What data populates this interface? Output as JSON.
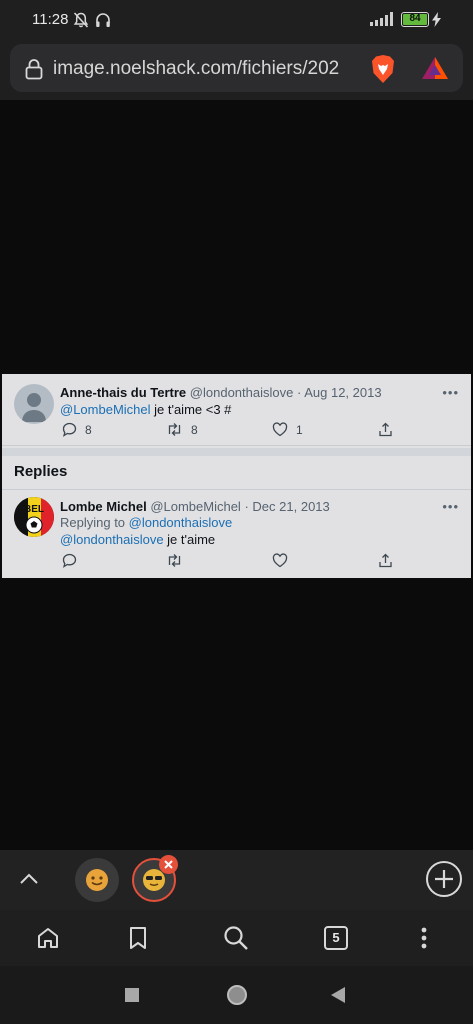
{
  "status_bar": {
    "time": "11:28",
    "battery": "84",
    "icons": [
      "mute-bell-icon",
      "headphones-icon",
      "signal-icon",
      "battery-icon",
      "charging-icon"
    ]
  },
  "browser": {
    "url": "image.noelshack.com/fichiers/202",
    "icons": [
      "lock-icon",
      "brave-shields-icon",
      "brave-rewards-icon"
    ],
    "accent": "#e5503b"
  },
  "tweet": {
    "name": "Anne-thais du Tertre",
    "handle": "@londonthaislove",
    "separator": "·",
    "date": "Aug 12, 2013",
    "mention": "@LombeMichel",
    "text": " je t'aime <3 #",
    "replies": "8",
    "retweets": "8",
    "likes": "1",
    "more": "•••"
  },
  "replies_section": {
    "title": "Replies"
  },
  "reply": {
    "name": "Lombe Michel",
    "handle": "@LombeMichel",
    "separator": "·",
    "date": "Dec 21, 2013",
    "replying_to_label": "Replying to ",
    "replying_to_handle": "@londonthaislove",
    "mention": "@londonthaislove",
    "text": " je t'aime",
    "avatar_text": "BEL",
    "more": "•••"
  },
  "bottom": {
    "tab_count": "5"
  },
  "colors": {
    "link": "#1b6fb4",
    "card_bg": "#e1e1e3",
    "page_bg": "#0b0b0b"
  }
}
